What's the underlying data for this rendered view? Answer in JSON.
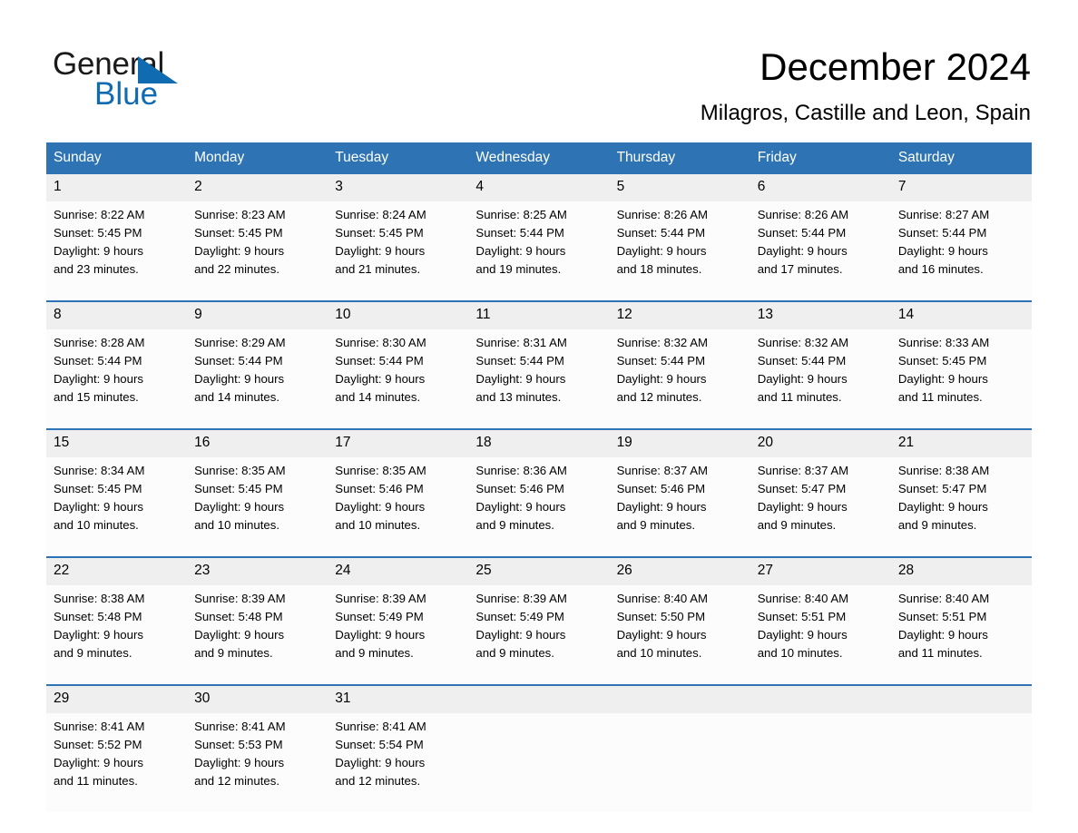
{
  "brand": {
    "name_part1": "General",
    "name_part2": "Blue",
    "logo_icon": "triangle-flag-icon",
    "accent_color": "#106BB0"
  },
  "header": {
    "title": "December 2024",
    "subtitle": "Milagros, Castille and Leon, Spain"
  },
  "colors": {
    "header_blue": "#2E74B5",
    "daynum_gray": "#EFEFEF",
    "text_black": "#000000"
  },
  "weekdays": [
    "Sunday",
    "Monday",
    "Tuesday",
    "Wednesday",
    "Thursday",
    "Friday",
    "Saturday"
  ],
  "weeks": [
    {
      "days": [
        {
          "date": "1",
          "sunrise": "Sunrise: 8:22 AM",
          "sunset": "Sunset: 5:45 PM",
          "daylight_line1": "Daylight: 9 hours",
          "daylight_line2": "and 23 minutes."
        },
        {
          "date": "2",
          "sunrise": "Sunrise: 8:23 AM",
          "sunset": "Sunset: 5:45 PM",
          "daylight_line1": "Daylight: 9 hours",
          "daylight_line2": "and 22 minutes."
        },
        {
          "date": "3",
          "sunrise": "Sunrise: 8:24 AM",
          "sunset": "Sunset: 5:45 PM",
          "daylight_line1": "Daylight: 9 hours",
          "daylight_line2": "and 21 minutes."
        },
        {
          "date": "4",
          "sunrise": "Sunrise: 8:25 AM",
          "sunset": "Sunset: 5:44 PM",
          "daylight_line1": "Daylight: 9 hours",
          "daylight_line2": "and 19 minutes."
        },
        {
          "date": "5",
          "sunrise": "Sunrise: 8:26 AM",
          "sunset": "Sunset: 5:44 PM",
          "daylight_line1": "Daylight: 9 hours",
          "daylight_line2": "and 18 minutes."
        },
        {
          "date": "6",
          "sunrise": "Sunrise: 8:26 AM",
          "sunset": "Sunset: 5:44 PM",
          "daylight_line1": "Daylight: 9 hours",
          "daylight_line2": "and 17 minutes."
        },
        {
          "date": "7",
          "sunrise": "Sunrise: 8:27 AM",
          "sunset": "Sunset: 5:44 PM",
          "daylight_line1": "Daylight: 9 hours",
          "daylight_line2": "and 16 minutes."
        }
      ]
    },
    {
      "days": [
        {
          "date": "8",
          "sunrise": "Sunrise: 8:28 AM",
          "sunset": "Sunset: 5:44 PM",
          "daylight_line1": "Daylight: 9 hours",
          "daylight_line2": "and 15 minutes."
        },
        {
          "date": "9",
          "sunrise": "Sunrise: 8:29 AM",
          "sunset": "Sunset: 5:44 PM",
          "daylight_line1": "Daylight: 9 hours",
          "daylight_line2": "and 14 minutes."
        },
        {
          "date": "10",
          "sunrise": "Sunrise: 8:30 AM",
          "sunset": "Sunset: 5:44 PM",
          "daylight_line1": "Daylight: 9 hours",
          "daylight_line2": "and 14 minutes."
        },
        {
          "date": "11",
          "sunrise": "Sunrise: 8:31 AM",
          "sunset": "Sunset: 5:44 PM",
          "daylight_line1": "Daylight: 9 hours",
          "daylight_line2": "and 13 minutes."
        },
        {
          "date": "12",
          "sunrise": "Sunrise: 8:32 AM",
          "sunset": "Sunset: 5:44 PM",
          "daylight_line1": "Daylight: 9 hours",
          "daylight_line2": "and 12 minutes."
        },
        {
          "date": "13",
          "sunrise": "Sunrise: 8:32 AM",
          "sunset": "Sunset: 5:44 PM",
          "daylight_line1": "Daylight: 9 hours",
          "daylight_line2": "and 11 minutes."
        },
        {
          "date": "14",
          "sunrise": "Sunrise: 8:33 AM",
          "sunset": "Sunset: 5:45 PM",
          "daylight_line1": "Daylight: 9 hours",
          "daylight_line2": "and 11 minutes."
        }
      ]
    },
    {
      "days": [
        {
          "date": "15",
          "sunrise": "Sunrise: 8:34 AM",
          "sunset": "Sunset: 5:45 PM",
          "daylight_line1": "Daylight: 9 hours",
          "daylight_line2": "and 10 minutes."
        },
        {
          "date": "16",
          "sunrise": "Sunrise: 8:35 AM",
          "sunset": "Sunset: 5:45 PM",
          "daylight_line1": "Daylight: 9 hours",
          "daylight_line2": "and 10 minutes."
        },
        {
          "date": "17",
          "sunrise": "Sunrise: 8:35 AM",
          "sunset": "Sunset: 5:46 PM",
          "daylight_line1": "Daylight: 9 hours",
          "daylight_line2": "and 10 minutes."
        },
        {
          "date": "18",
          "sunrise": "Sunrise: 8:36 AM",
          "sunset": "Sunset: 5:46 PM",
          "daylight_line1": "Daylight: 9 hours",
          "daylight_line2": "and 9 minutes."
        },
        {
          "date": "19",
          "sunrise": "Sunrise: 8:37 AM",
          "sunset": "Sunset: 5:46 PM",
          "daylight_line1": "Daylight: 9 hours",
          "daylight_line2": "and 9 minutes."
        },
        {
          "date": "20",
          "sunrise": "Sunrise: 8:37 AM",
          "sunset": "Sunset: 5:47 PM",
          "daylight_line1": "Daylight: 9 hours",
          "daylight_line2": "and 9 minutes."
        },
        {
          "date": "21",
          "sunrise": "Sunrise: 8:38 AM",
          "sunset": "Sunset: 5:47 PM",
          "daylight_line1": "Daylight: 9 hours",
          "daylight_line2": "and 9 minutes."
        }
      ]
    },
    {
      "days": [
        {
          "date": "22",
          "sunrise": "Sunrise: 8:38 AM",
          "sunset": "Sunset: 5:48 PM",
          "daylight_line1": "Daylight: 9 hours",
          "daylight_line2": "and 9 minutes."
        },
        {
          "date": "23",
          "sunrise": "Sunrise: 8:39 AM",
          "sunset": "Sunset: 5:48 PM",
          "daylight_line1": "Daylight: 9 hours",
          "daylight_line2": "and 9 minutes."
        },
        {
          "date": "24",
          "sunrise": "Sunrise: 8:39 AM",
          "sunset": "Sunset: 5:49 PM",
          "daylight_line1": "Daylight: 9 hours",
          "daylight_line2": "and 9 minutes."
        },
        {
          "date": "25",
          "sunrise": "Sunrise: 8:39 AM",
          "sunset": "Sunset: 5:49 PM",
          "daylight_line1": "Daylight: 9 hours",
          "daylight_line2": "and 9 minutes."
        },
        {
          "date": "26",
          "sunrise": "Sunrise: 8:40 AM",
          "sunset": "Sunset: 5:50 PM",
          "daylight_line1": "Daylight: 9 hours",
          "daylight_line2": "and 10 minutes."
        },
        {
          "date": "27",
          "sunrise": "Sunrise: 8:40 AM",
          "sunset": "Sunset: 5:51 PM",
          "daylight_line1": "Daylight: 9 hours",
          "daylight_line2": "and 10 minutes."
        },
        {
          "date": "28",
          "sunrise": "Sunrise: 8:40 AM",
          "sunset": "Sunset: 5:51 PM",
          "daylight_line1": "Daylight: 9 hours",
          "daylight_line2": "and 11 minutes."
        }
      ]
    },
    {
      "days": [
        {
          "date": "29",
          "sunrise": "Sunrise: 8:41 AM",
          "sunset": "Sunset: 5:52 PM",
          "daylight_line1": "Daylight: 9 hours",
          "daylight_line2": "and 11 minutes."
        },
        {
          "date": "30",
          "sunrise": "Sunrise: 8:41 AM",
          "sunset": "Sunset: 5:53 PM",
          "daylight_line1": "Daylight: 9 hours",
          "daylight_line2": "and 12 minutes."
        },
        {
          "date": "31",
          "sunrise": "Sunrise: 8:41 AM",
          "sunset": "Sunset: 5:54 PM",
          "daylight_line1": "Daylight: 9 hours",
          "daylight_line2": "and 12 minutes."
        },
        {
          "date": "",
          "sunrise": "",
          "sunset": "",
          "daylight_line1": "",
          "daylight_line2": ""
        },
        {
          "date": "",
          "sunrise": "",
          "sunset": "",
          "daylight_line1": "",
          "daylight_line2": ""
        },
        {
          "date": "",
          "sunrise": "",
          "sunset": "",
          "daylight_line1": "",
          "daylight_line2": ""
        },
        {
          "date": "",
          "sunrise": "",
          "sunset": "",
          "daylight_line1": "",
          "daylight_line2": ""
        }
      ]
    }
  ]
}
